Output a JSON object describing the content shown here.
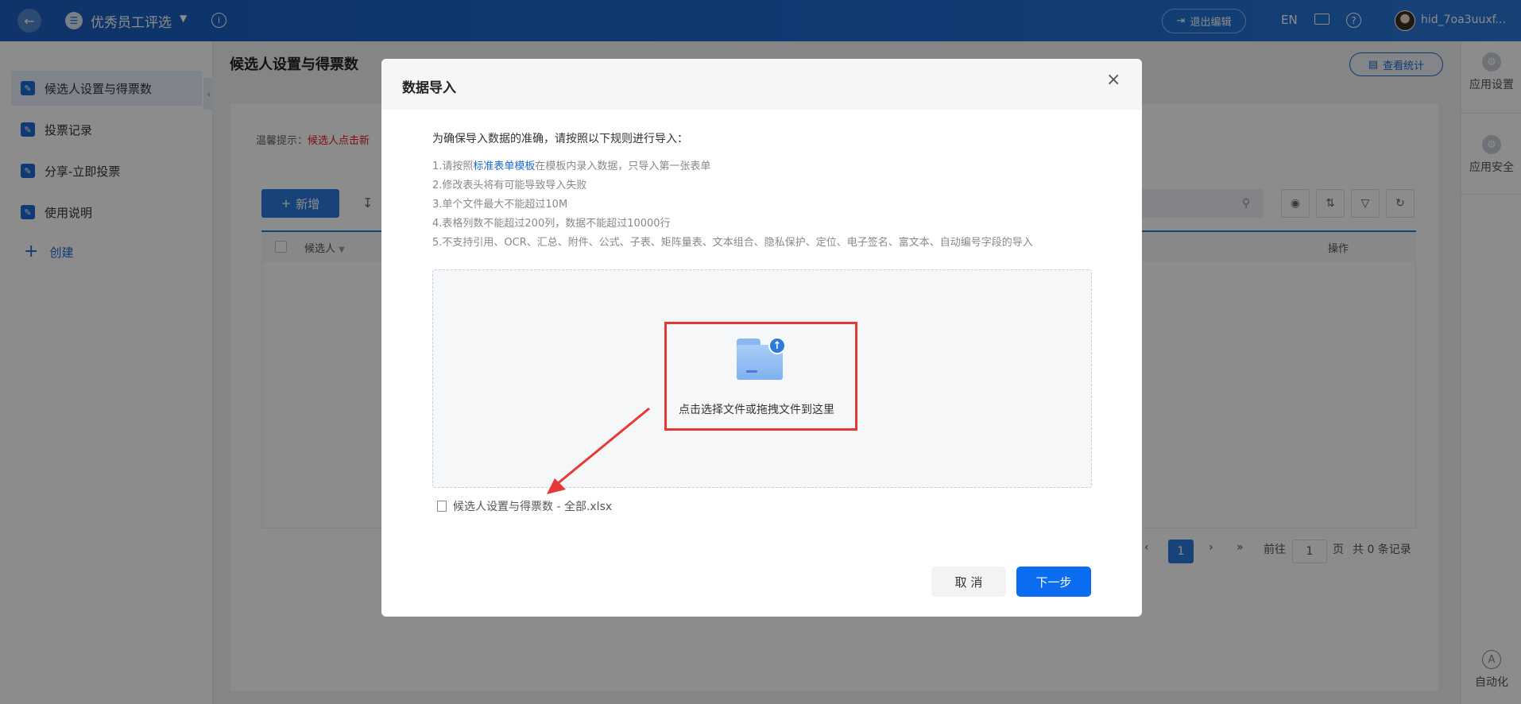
{
  "topbar": {
    "app_icon": "document-icon",
    "app_title": "优秀员工评选",
    "exit_edit": "退出编辑",
    "lang": "EN",
    "username": "hid_7oa3uuxf..."
  },
  "sidebar": {
    "items": [
      {
        "label": "候选人设置与得票数",
        "icon": "document-icon"
      },
      {
        "label": "投票记录",
        "icon": "document-icon"
      },
      {
        "label": "分享-立即投票",
        "icon": "document-icon"
      },
      {
        "label": "使用说明",
        "icon": "document-icon"
      }
    ],
    "create_label": "创建"
  },
  "rightbar": {
    "app_settings": "应用设置",
    "app_security": "应用安全",
    "automation": "自动化"
  },
  "main": {
    "page_title": "候选人设置与得票数",
    "stats_button": "查看统计",
    "tip_prefix": "温馨提示：",
    "tip_red": "候选人点击新",
    "add_button": "新增",
    "columns": {
      "candidate": "候选人",
      "ops": "操作"
    },
    "pager": {
      "current": "1",
      "goto_label": "前往",
      "goto_value": "1",
      "page_unit": "页",
      "total": "共 0 条记录"
    }
  },
  "modal": {
    "title": "数据导入",
    "rules_title": "为确保导入数据的准确，请按照以下规则进行导入：",
    "rules": {
      "r1_prefix": "1.请按照",
      "r1_link": "标准表单模板",
      "r1_suffix": "在模板内录入数据，只导入第一张表单",
      "r2": "2.修改表头将有可能导致导入失败",
      "r3": "3.单个文件最大不能超过10M",
      "r4": "4.表格列数不能超过200列，数据不能超过10000行",
      "r5": "5.不支持引用、OCR、汇总、附件、公式、子表、矩阵量表、文本组合、隐私保护、定位、电子签名、富文本、自动编号字段的导入"
    },
    "dropzone_text": "点击选择文件或拖拽文件到这里",
    "file_name": "候选人设置与得票数 - 全部.xlsx",
    "cancel_button": "取 消",
    "next_button": "下一步",
    "highlight_color": "#e53935",
    "primary_color": "#0a6cf0"
  }
}
